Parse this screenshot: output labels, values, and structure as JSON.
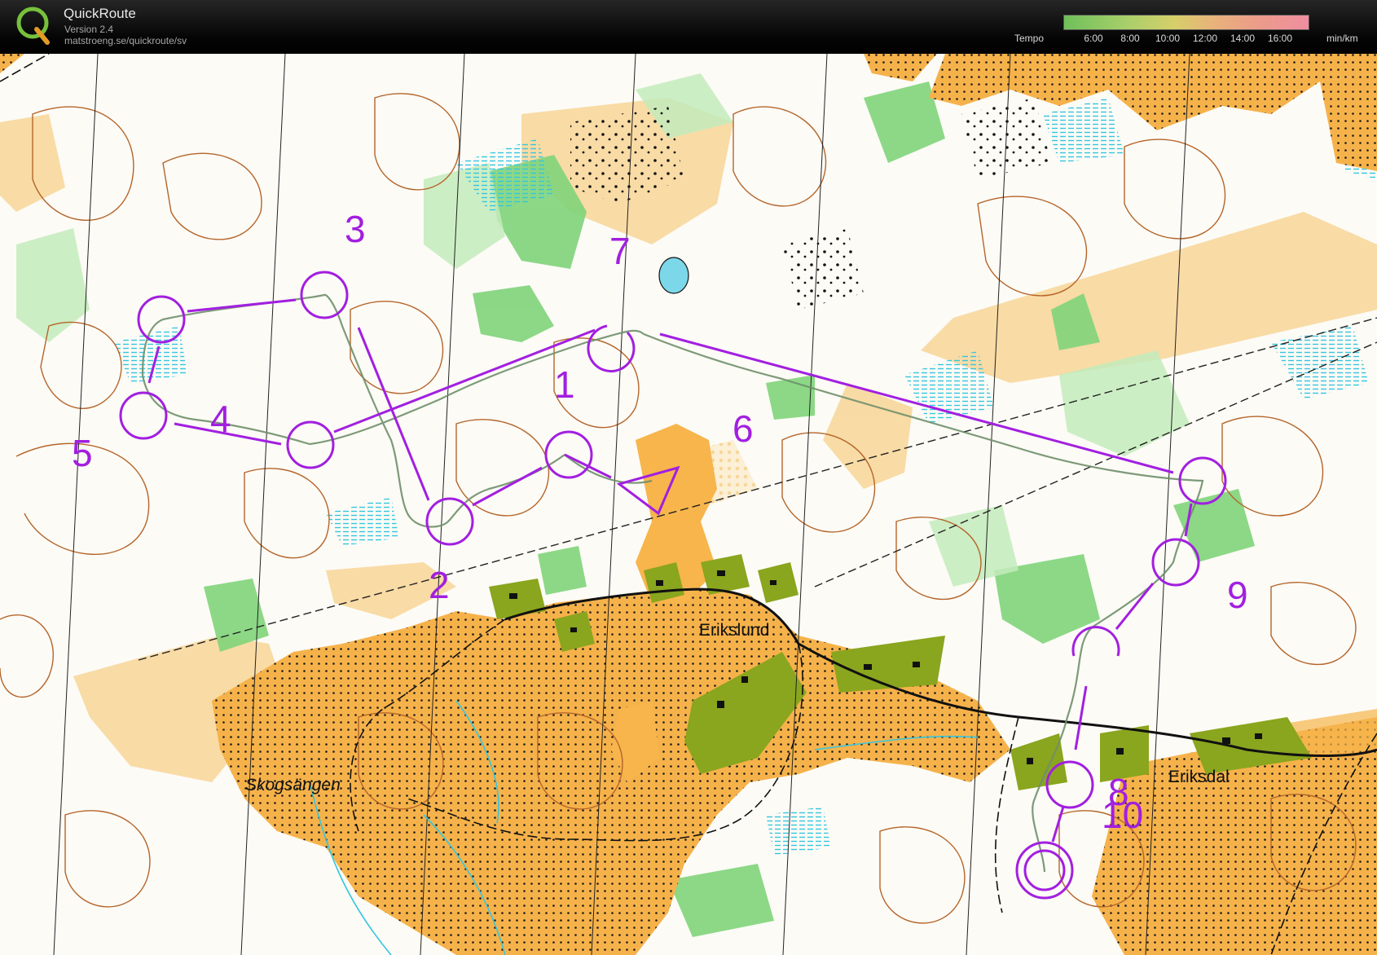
{
  "header": {
    "app_title": "QuickRoute",
    "version": "Version 2.4",
    "url": "matstroeng.se/quickroute/sv",
    "tempo_label": "Tempo",
    "tempo_unit": "min/km",
    "tempo_ticks": [
      "6:00",
      "8:00",
      "10:00",
      "12:00",
      "14:00",
      "16:00"
    ],
    "logo_letter": "Q"
  },
  "map": {
    "place_names": {
      "erikslund": "Erikslund",
      "skogsangen": "Skogsängen",
      "eriksdal": "Eriksdal"
    },
    "controls": [
      {
        "number": "1"
      },
      {
        "number": "2"
      },
      {
        "number": "3"
      },
      {
        "number": "4"
      },
      {
        "number": "5"
      },
      {
        "number": "6"
      },
      {
        "number": "7"
      },
      {
        "number": "8"
      },
      {
        "number": "9"
      },
      {
        "number": "10"
      }
    ],
    "colors": {
      "course": "#a21fe0",
      "route": "#6f8f6a",
      "open_land": "#f7b54c",
      "rough_open": "#f8d596",
      "forest_green": "#7fd47a",
      "marsh": "#35c6df",
      "settlement": "#8aa51e",
      "contour": "#b5652a"
    }
  }
}
